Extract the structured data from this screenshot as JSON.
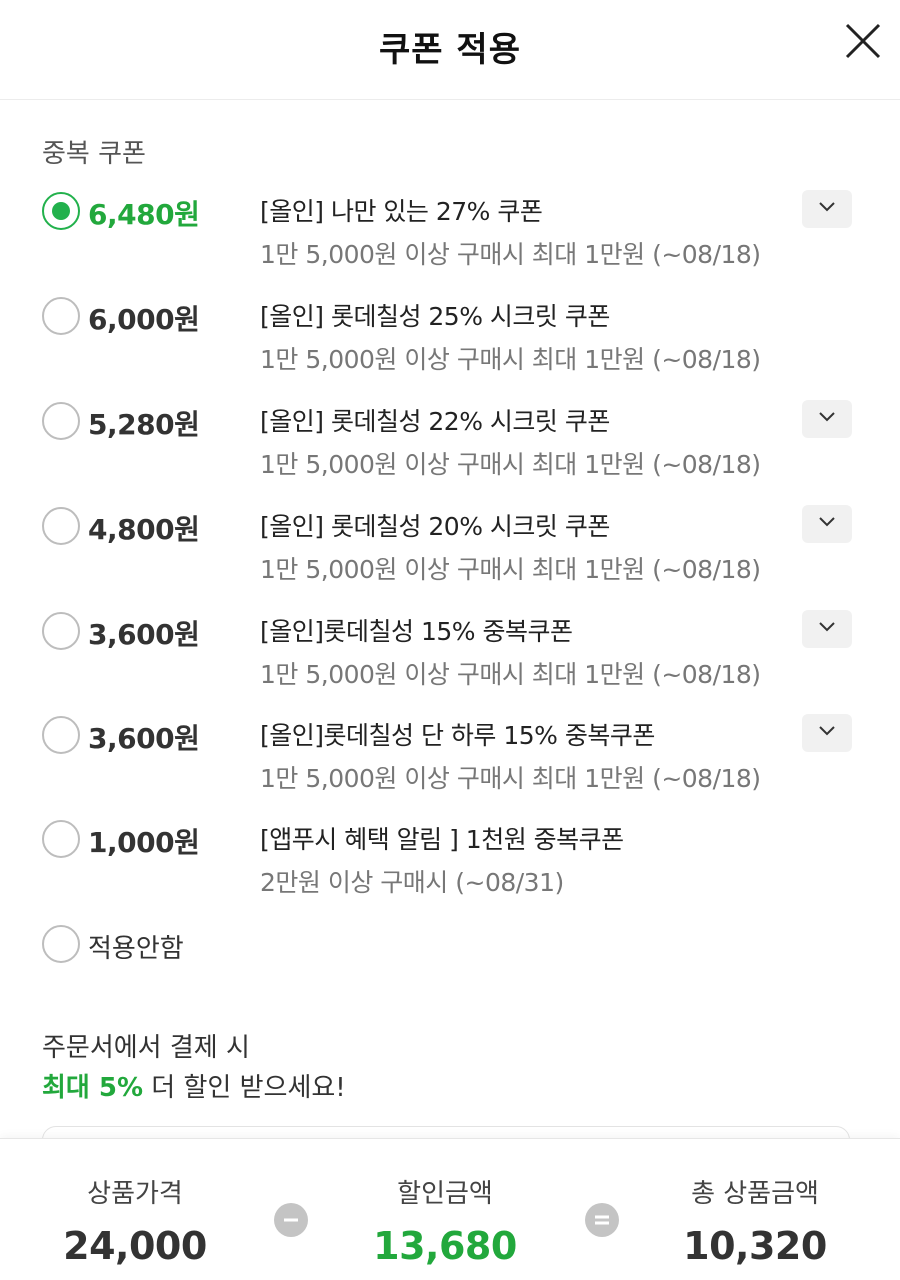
{
  "header": {
    "title": "쿠폰 적용"
  },
  "section": {
    "label": "중복 쿠폰"
  },
  "coupons": [
    {
      "amount": "6,480원",
      "name": "[올인] 나만 있는 27% 쿠폰",
      "condition": "1만 5,000원 이상 구매시 최대 1만원 (~08/18)",
      "selected": true,
      "expandable": true
    },
    {
      "amount": "6,000원",
      "name": "[올인] 롯데칠성 25% 시크릿 쿠폰",
      "condition": "1만 5,000원 이상 구매시 최대 1만원 (~08/18)",
      "selected": false,
      "expandable": false
    },
    {
      "amount": "5,280원",
      "name": "[올인] 롯데칠성 22% 시크릿 쿠폰",
      "condition": "1만 5,000원 이상 구매시 최대 1만원 (~08/18)",
      "selected": false,
      "expandable": true
    },
    {
      "amount": "4,800원",
      "name": "[올인] 롯데칠성 20% 시크릿 쿠폰",
      "condition": "1만 5,000원 이상 구매시 최대 1만원 (~08/18)",
      "selected": false,
      "expandable": true
    },
    {
      "amount": "3,600원",
      "name": "[올인]롯데칠성 15% 중복쿠폰",
      "condition": "1만 5,000원 이상 구매시 최대 1만원 (~08/18)",
      "selected": false,
      "expandable": true
    },
    {
      "amount": "3,600원",
      "name": "[올인]롯데칠성 단 하루 15% 중복쿠폰",
      "condition": "1만 5,000원 이상 구매시 최대 1만원 (~08/18)",
      "selected": false,
      "expandable": true
    },
    {
      "amount": "1,000원",
      "name": "[앱푸시 혜택 알림 ] 1천원 중복쿠폰",
      "condition": "2만원 이상 구매시 (~08/31)",
      "selected": false,
      "expandable": false
    }
  ],
  "no_coupon": {
    "label": "적용안함"
  },
  "promo": {
    "line1": "주문서에서 결제 시",
    "highlight": "최대 5%",
    "line2_rest": " 더 할인 받으세요!"
  },
  "summary": {
    "product_price_label": "상품가격",
    "product_price": "24,000",
    "discount_label": "할인금액",
    "discount": "13,680",
    "total_label": "총 상품금액",
    "total": "10,320"
  },
  "colors": {
    "accent_green": "#22a83c",
    "radio_border": "#bdbdbd",
    "operator_gray": "#c4c4c4"
  },
  "icons": {
    "close": "close-icon",
    "expand": "chevron-down-icon",
    "minus": "minus-icon",
    "equals": "equals-icon"
  }
}
